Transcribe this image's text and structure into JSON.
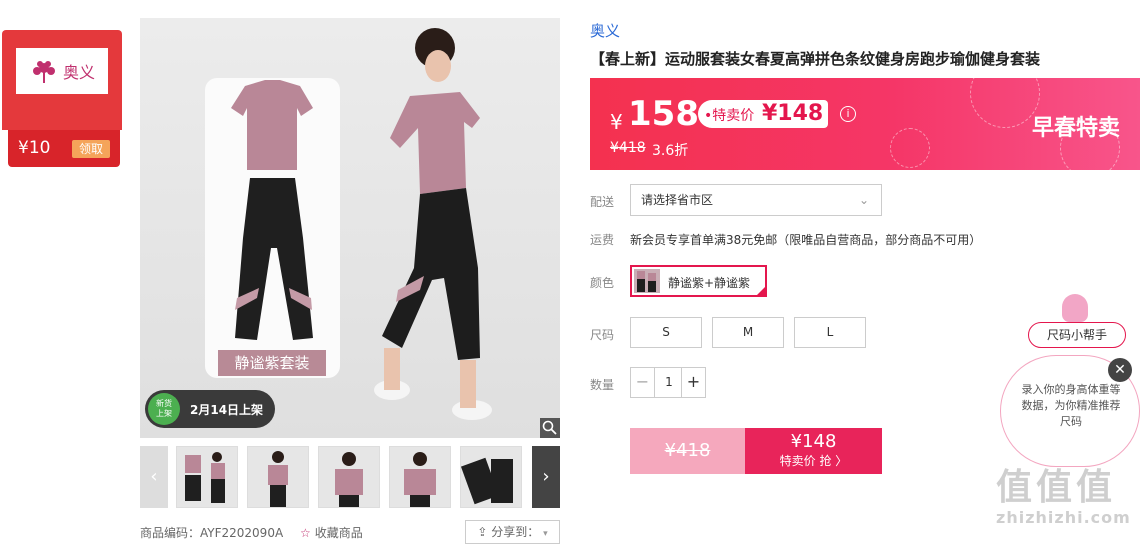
{
  "coupon": {
    "brand": "奥义",
    "amount": "¥10",
    "claim": "领取"
  },
  "gallery": {
    "set_label": "静谧紫套装",
    "new_badge_line1": "新货",
    "new_badge_line2": "上架",
    "launch_date": "2月14日上架",
    "thumbnail_count": 5
  },
  "meta": {
    "sku": "商品编码：AYF2202090A",
    "favorite": "收藏商品",
    "share": "分享到："
  },
  "product": {
    "brand": "奥义",
    "title": "【春上新】运动服套装女春夏高弹拼色条纹健身房跑步瑜伽健身套装"
  },
  "price": {
    "currency": "¥",
    "now": "158",
    "special_label": "•特卖价",
    "special_value": "¥148",
    "original": "¥418",
    "discount": "3.6折",
    "promo_name": "早春特卖",
    "color_banner": "#f4314f"
  },
  "delivery": {
    "label": "配送",
    "value": "请选择省市区"
  },
  "shipping": {
    "label": "运费",
    "text": "新会员专享首单满38元免邮（限唯品自营商品，部分商品不可用）"
  },
  "color": {
    "label": "颜色",
    "option": "静谧紫+静谧紫"
  },
  "size": {
    "label": "尺码",
    "options": [
      "S",
      "M",
      "L"
    ]
  },
  "quantity": {
    "label": "数量",
    "value": "1",
    "minus": "−",
    "plus": "+"
  },
  "buy": {
    "original": "¥418",
    "amount": "¥148",
    "cta": "特卖价 抢 〉"
  },
  "helper": {
    "title": "尺码小帮手",
    "text": "录入你的身高体重等数据，为你精准推荐尺码",
    "close": "✕"
  },
  "watermark": {
    "logo": "值值值",
    "text": "zhizhizhi.com"
  }
}
